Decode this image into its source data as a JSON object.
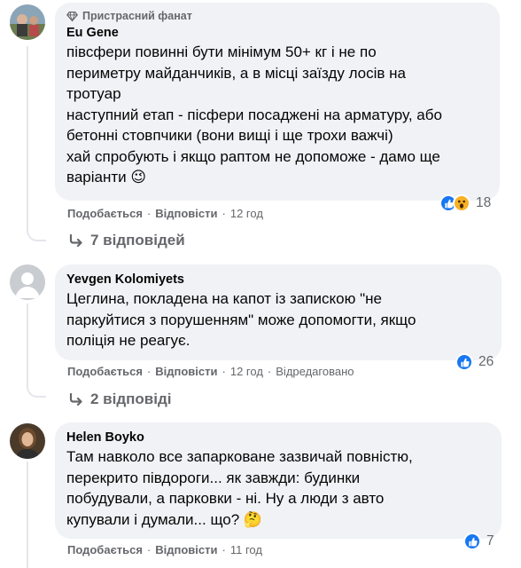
{
  "comments": [
    {
      "badge": "Пристрасний фанат",
      "author": "Eu Gene",
      "lines": [
        "півсфери повинні бути мінімум 50+ кг і не по",
        "периметру майданчиків, а в місці заїзду лосів на",
        "тротуар",
        "наступний етап - пісфери посаджені на арматуру, або",
        "бетонні стовпчики (вони вищі і ще трохи важчі)",
        "хай спробують і якщо раптом не допоможе - дамо ще",
        "варіанти 😉"
      ],
      "like": "Подобається",
      "reply": "Відповісти",
      "time": "12 год",
      "reaction_count": "18",
      "reaction_icons": [
        "like-icon",
        "wow-icon"
      ],
      "replies_label": "7 відповідей"
    },
    {
      "author": "Yevgen Kolomiyets",
      "lines": [
        "Цеглина, покладена на капот із запискою \"не",
        "паркуйтися з порушенням\" може допомогти, якщо",
        "поліція не реагує."
      ],
      "like": "Подобається",
      "reply": "Відповісти",
      "time": "12 год",
      "edited": "Відредаговано",
      "reaction_count": "26",
      "reaction_icons": [
        "like-icon"
      ],
      "replies_label": "2 відповіді"
    },
    {
      "author": "Helen Boyko",
      "lines": [
        "Там навколо все запарковане зазвичай повністю,",
        "перекрито півдороги... як завжди: будинки",
        "побудували, а парковки - ні. Ну а люди з авто",
        "купували і думали... що? 🤔"
      ],
      "like": "Подобається",
      "reply": "Відповісти",
      "time": "11 год",
      "reaction_count": "7",
      "reaction_icons": [
        "like-icon"
      ]
    }
  ],
  "colors": {
    "bubble": "#f0f2f5",
    "like_blue": "#1877f2",
    "meta": "#65676b",
    "wow_yellow": "#f7b125"
  }
}
